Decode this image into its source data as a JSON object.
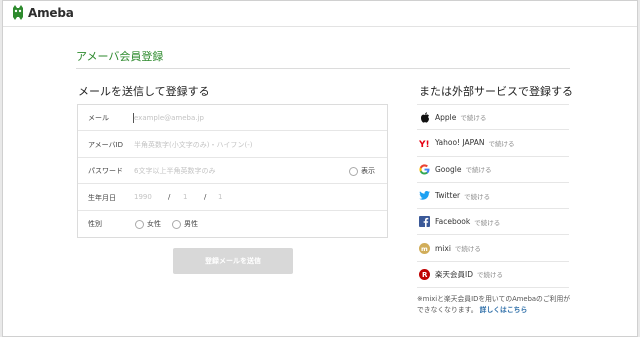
{
  "brand": {
    "logo_text": "Ameba"
  },
  "page": {
    "title": "アメーバ会員登録"
  },
  "email_section": {
    "heading": "メールを送信して登録する",
    "fields": {
      "email": {
        "label": "メール",
        "placeholder": "example@ameba.jp"
      },
      "ameba_id": {
        "label": "アメーバID",
        "placeholder": "半角英数字(小文字のみ)・ハイフン(-)"
      },
      "password": {
        "label": "パスワード",
        "placeholder": "6文字以上半角英数字のみ",
        "show_label": "表示"
      },
      "birthdate": {
        "label": "生年月日",
        "year": "1990",
        "month": "1",
        "day": "1",
        "separator": "/"
      },
      "gender": {
        "label": "性別",
        "options": [
          "女性",
          "男性"
        ]
      }
    },
    "submit_label": "登録メールを送信"
  },
  "external_section": {
    "heading": "または外部サービスで登録する",
    "suffix": "で続ける",
    "services": [
      {
        "name": "Apple",
        "icon": "apple-icon"
      },
      {
        "name": "Yahoo! JAPAN",
        "icon": "yahoo-icon"
      },
      {
        "name": "Google",
        "icon": "google-icon"
      },
      {
        "name": "Twitter",
        "icon": "twitter-icon"
      },
      {
        "name": "Facebook",
        "icon": "facebook-icon"
      },
      {
        "name": "mixi",
        "icon": "mixi-icon"
      },
      {
        "name": "楽天会員ID",
        "icon": "rakuten-icon"
      }
    ],
    "note_text": "※mixiと楽天会員IDを用いてのAmebaのご利用ができなくなります。",
    "note_link": "詳しくはこちら"
  },
  "colors": {
    "brand_green": "#2d8a2d",
    "yahoo_red": "#e60012",
    "twitter_blue": "#1da1f2",
    "facebook_blue": "#3b5998",
    "mixi_orange": "#d1ad59",
    "rakuten_red": "#bf0000",
    "link_blue": "#2d6ea8"
  }
}
